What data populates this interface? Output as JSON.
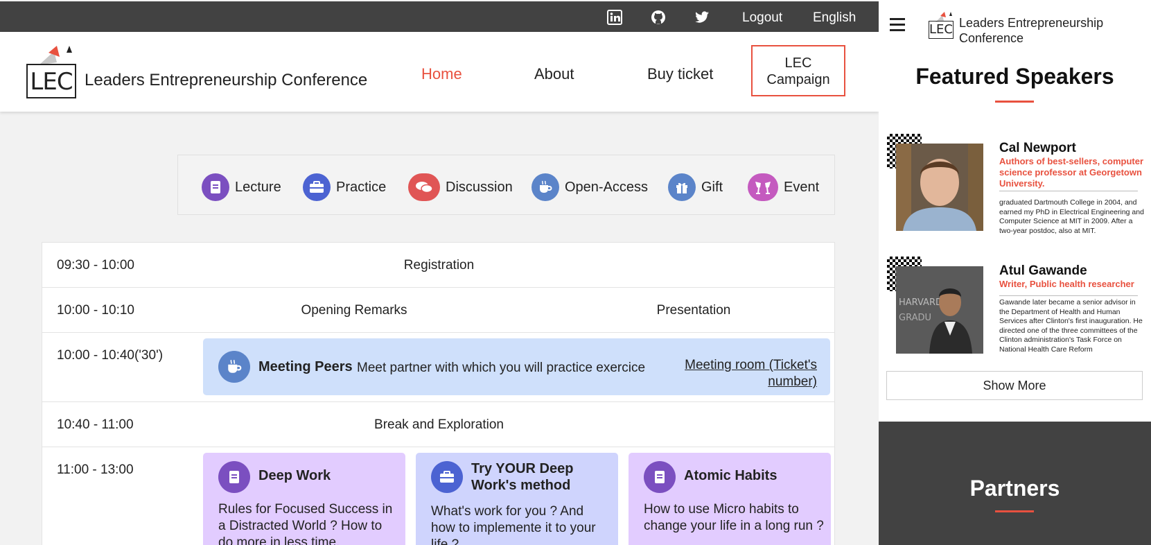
{
  "topbar": {
    "icons": [
      "linkedin-icon",
      "github-icon",
      "twitter-icon"
    ],
    "logout": "Logout",
    "language": "English"
  },
  "brand": {
    "logo_text": "LEC",
    "name": "Leaders Entrepreneurship Conference"
  },
  "nav": {
    "home": "Home",
    "about": "About",
    "buy": "Buy ticket",
    "campaign_line1": "LEC",
    "campaign_line2": "Campaign"
  },
  "legend": [
    {
      "label": "Lecture",
      "icon": "book-icon",
      "color": "#7b4fc0"
    },
    {
      "label": "Practice",
      "icon": "briefcase-icon",
      "color": "#4c63d2"
    },
    {
      "label": "Discussion",
      "icon": "chat-bubbles-icon",
      "color": "#e05555"
    },
    {
      "label": "Open-Access",
      "icon": "coffee-cup-icon",
      "color": "#5b84c9"
    },
    {
      "label": "Gift",
      "icon": "gift-icon",
      "color": "#5b84c9"
    },
    {
      "label": "Event",
      "icon": "champagne-glasses-icon",
      "color": "#c45abf"
    }
  ],
  "schedule": {
    "r1_time": "09:30 - 10:00",
    "r1_title": "Registration",
    "r2_time": "10:00 - 10:10",
    "r2_left": "Opening Remarks",
    "r2_right": "Presentation",
    "r3_time": "10:00 - 10:40('30')",
    "r3_title": "Meeting Peers",
    "r3_desc": "Meet partner with which you will practice exercice",
    "r3_link": "Meeting room (Ticket's number)",
    "r4_time": "10:40 - 11:00",
    "r4_title": "Break and Exploration",
    "r5_time": "11:00 - 13:00",
    "cards": [
      {
        "title": "Deep Work",
        "desc": "Rules for Focused Success in a Distracted World ? How to do more in less time.",
        "color": "#e2ccff"
      },
      {
        "title": "Try YOUR Deep Work's method",
        "desc": "What's work for you ? And how to implemente it to your life ?",
        "color": "#cfd4fd"
      },
      {
        "title": "Atomic Habits",
        "desc": "How to use Micro habits to change your life in a long run ?",
        "color": "#e2ccff"
      }
    ]
  },
  "right_panel": {
    "brand_line1": "Leaders Entrepreneurship",
    "brand_line2": "Conference",
    "featured_title": "Featured Speakers",
    "speakers": [
      {
        "name": "Cal Newport",
        "role": "Authors of best-sellers, computer science professor at Georgetown University.",
        "bio": "graduated Dartmouth College in 2004, and earned my PhD in Electrical Engineering and Computer Science at MIT in 2009. After a two-year postdoc, also at MIT."
      },
      {
        "name": "Atul Gawande",
        "role": "Writer, Public health researcher",
        "bio": "Gawande later became a senior advisor in the Department of Health and Human Services after Clinton's first inauguration. He directed one of the three committees of the Clinton administration's Task Force on National Health Care Reform"
      }
    ],
    "show_more": "Show More",
    "partners_title": "Partners"
  },
  "colors": {
    "accent": "#e8513f",
    "topbar": "#424242",
    "peer_card": "#cfe0fb"
  }
}
